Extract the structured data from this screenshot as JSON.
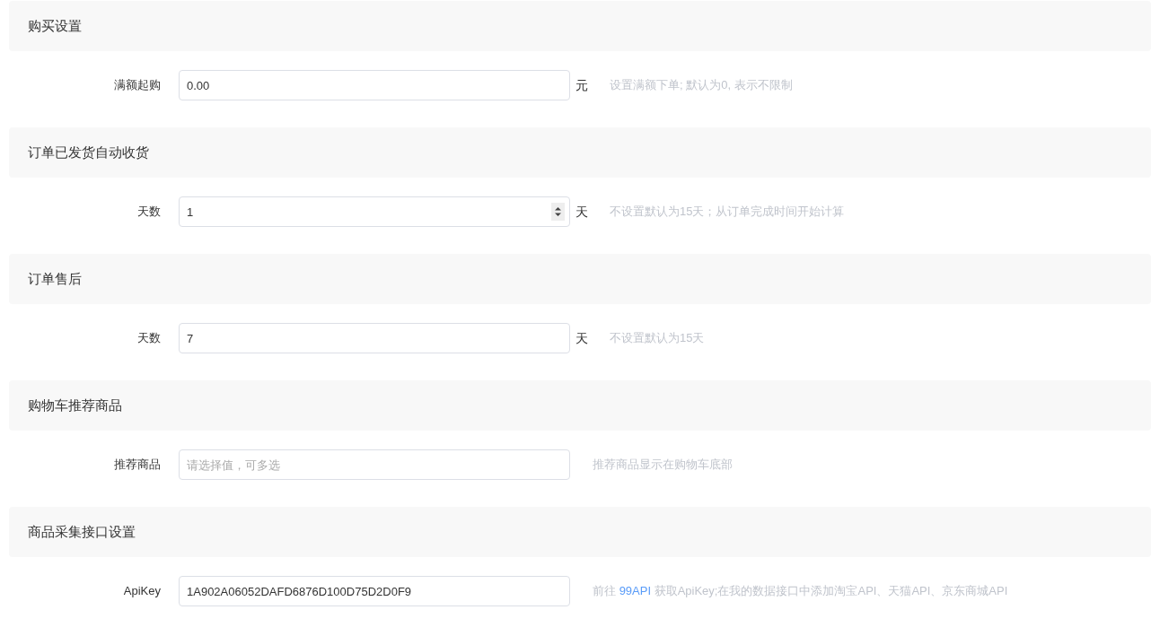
{
  "sections": [
    {
      "title": "购买设置",
      "fields": [
        {
          "label": "满额起购",
          "kind": "text",
          "value": "0.00",
          "unit": "元",
          "help": [
            {
              "kind": "text",
              "text": "设置满额下单; 默认为0, 表示不限制"
            }
          ]
        }
      ]
    },
    {
      "title": "订单已发货自动收货",
      "fields": [
        {
          "label": "天数",
          "kind": "number",
          "value": "1",
          "unit": "天",
          "help": [
            {
              "kind": "text",
              "text": "不设置默认为15天；从订单完成时间开始计算"
            }
          ]
        }
      ]
    },
    {
      "title": "订单售后",
      "fields": [
        {
          "label": "天数",
          "kind": "text",
          "value": "7",
          "unit": "天",
          "help": [
            {
              "kind": "text",
              "text": "不设置默认为15天"
            }
          ]
        }
      ]
    },
    {
      "title": "购物车推荐商品",
      "fields": [
        {
          "label": "推荐商品",
          "kind": "select",
          "placeholder": "请选择值，可多选",
          "help": [
            {
              "kind": "text",
              "text": "推荐商品显示在购物车底部"
            }
          ]
        }
      ]
    },
    {
      "title": "商品采集接口设置",
      "fields": [
        {
          "label": "ApiKey",
          "kind": "text",
          "value": "1A902A06052DAFD6876D100D75D2D0F9",
          "help": [
            {
              "kind": "text",
              "text": "前往 "
            },
            {
              "kind": "link",
              "text": "99API"
            },
            {
              "kind": "text",
              "text": " 获取ApiKey;在我的数据接口中添加淘宝API、天猫API、京东商城API"
            }
          ]
        }
      ]
    }
  ]
}
